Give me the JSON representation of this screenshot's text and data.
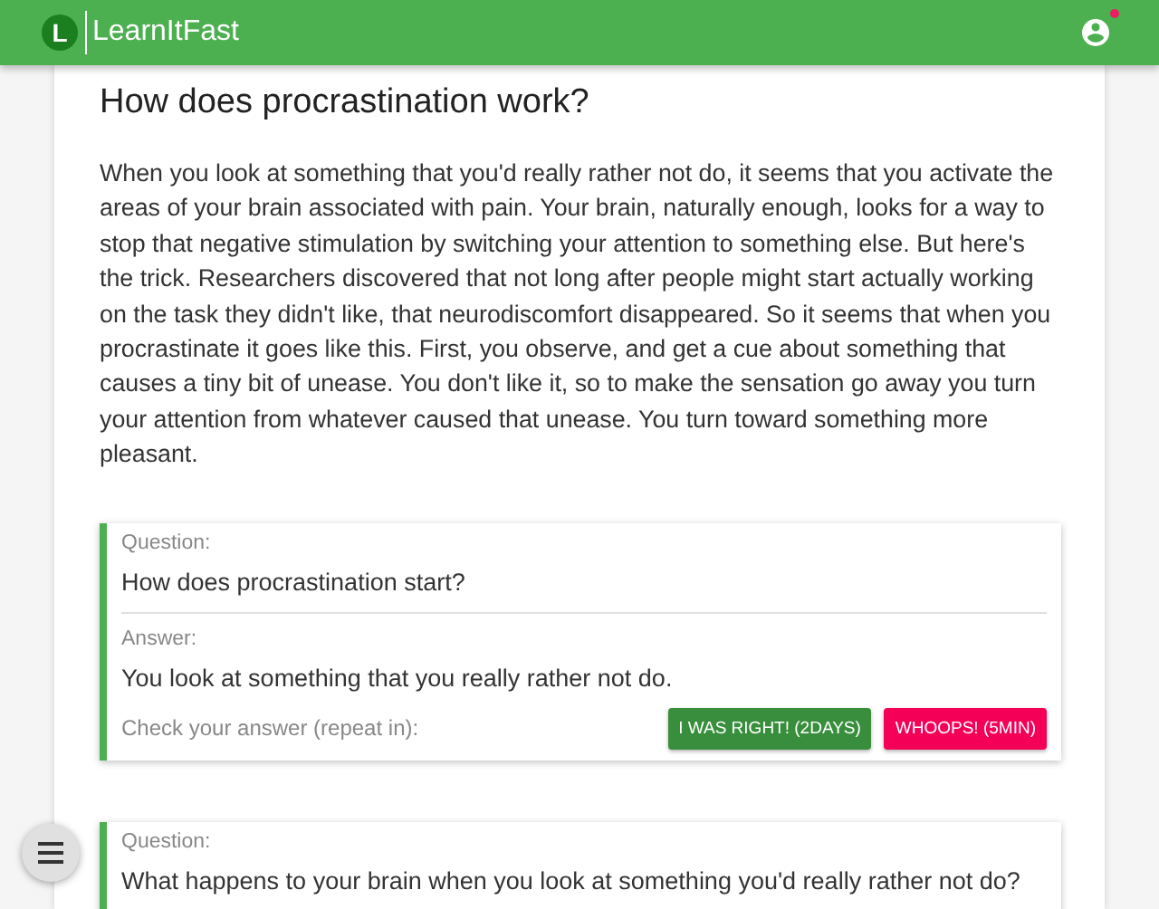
{
  "app": {
    "logo_letter": "L",
    "title": "LearnItFast",
    "notification": true
  },
  "article": {
    "heading": "How does procrastination work?",
    "body": "When you look at something that you'd really rather not do, it seems that you activate the areas of your brain associated with pain. Your brain, naturally enough, looks for a way to stop that negative stimulation by switching your attention to something else. But here's the trick. Researchers discovered that not long after people might start actually working on the task they didn't like, that neurodiscomfort disappeared. So it seems that when you procrastinate it goes like this. First, you observe, and get a cue about something that causes a tiny bit of unease. You don't like it, so to make the sensation go away you turn your attention from whatever caused that unease. You turn toward something more pleasant."
  },
  "flashcards": [
    {
      "question_label": "Question:",
      "question": "How does procrastination start?",
      "answer_label": "Answer:",
      "answer": "You look at something that you really rather not do.",
      "check_label": "Check your answer (repeat in):",
      "buttons": [
        {
          "label": "I WAS RIGHT! (2DAYS)",
          "kind": "right"
        },
        {
          "label": "WHOOPS! (5MIN)",
          "kind": "wrong"
        }
      ]
    },
    {
      "question_label": "Question:",
      "question": "What happens to your brain when you look at something you'd really rather not do?"
    }
  ]
}
